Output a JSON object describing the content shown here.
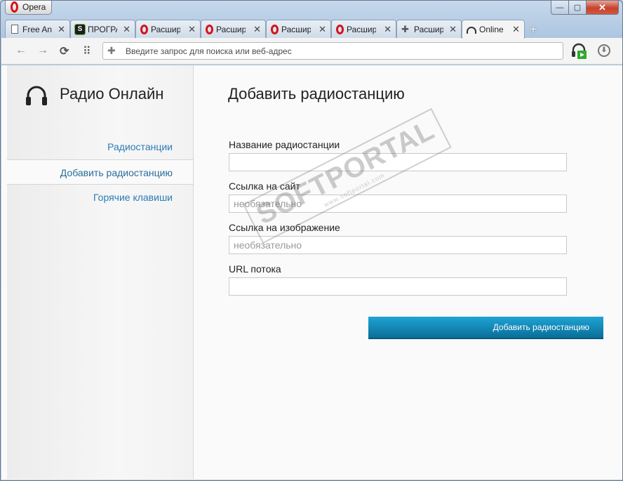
{
  "window": {
    "app_button": "Opera",
    "minimize": "—",
    "maximize": "▢",
    "close": "✕"
  },
  "tabs": [
    {
      "title": "Free An",
      "icon": "document-icon"
    },
    {
      "title": "ПРОГРА",
      "icon": "softportal-s-icon",
      "icon_text": "S"
    },
    {
      "title": "Расшир",
      "icon": "opera-icon"
    },
    {
      "title": "Расшир",
      "icon": "opera-icon"
    },
    {
      "title": "Расшир",
      "icon": "opera-icon"
    },
    {
      "title": "Расшир",
      "icon": "opera-icon"
    },
    {
      "title": "Расшир",
      "icon": "puzzle-icon"
    },
    {
      "title": "Online",
      "icon": "headphones-icon",
      "active": true
    }
  ],
  "tab_close_glyph": "✕",
  "new_tab_glyph": "+",
  "toolbar": {
    "back": "←",
    "forward": "→",
    "reload": "⟳",
    "speed_dial": "⠿",
    "address_placeholder": "Введите запрос для поиска или веб-адрес",
    "download_glyph": "⬇"
  },
  "sidebar": {
    "title": "Радио Онлайн",
    "items": [
      {
        "label": "Радиостанции",
        "active": false
      },
      {
        "label": "Добавить радиостанцию",
        "active": true
      },
      {
        "label": "Горячие клавиши",
        "active": false
      }
    ]
  },
  "main": {
    "heading": "Добавить радиостанцию",
    "fields": [
      {
        "label": "Название радиостанции",
        "value": "",
        "placeholder": ""
      },
      {
        "label": "Ссылка на сайт",
        "value": "",
        "placeholder": "необязательно"
      },
      {
        "label": "Ссылка на изображение",
        "value": "",
        "placeholder": "необязательно"
      },
      {
        "label": "URL потока",
        "value": "",
        "placeholder": ""
      }
    ],
    "submit_label": "Добавить радиостанцию"
  },
  "watermark": {
    "text": "SOFTPORTAL",
    "sub": "www.softportal.com"
  },
  "colors": {
    "accent": "#2a7bb5",
    "button": "#1188bb",
    "opera_red": "#d3141b"
  }
}
